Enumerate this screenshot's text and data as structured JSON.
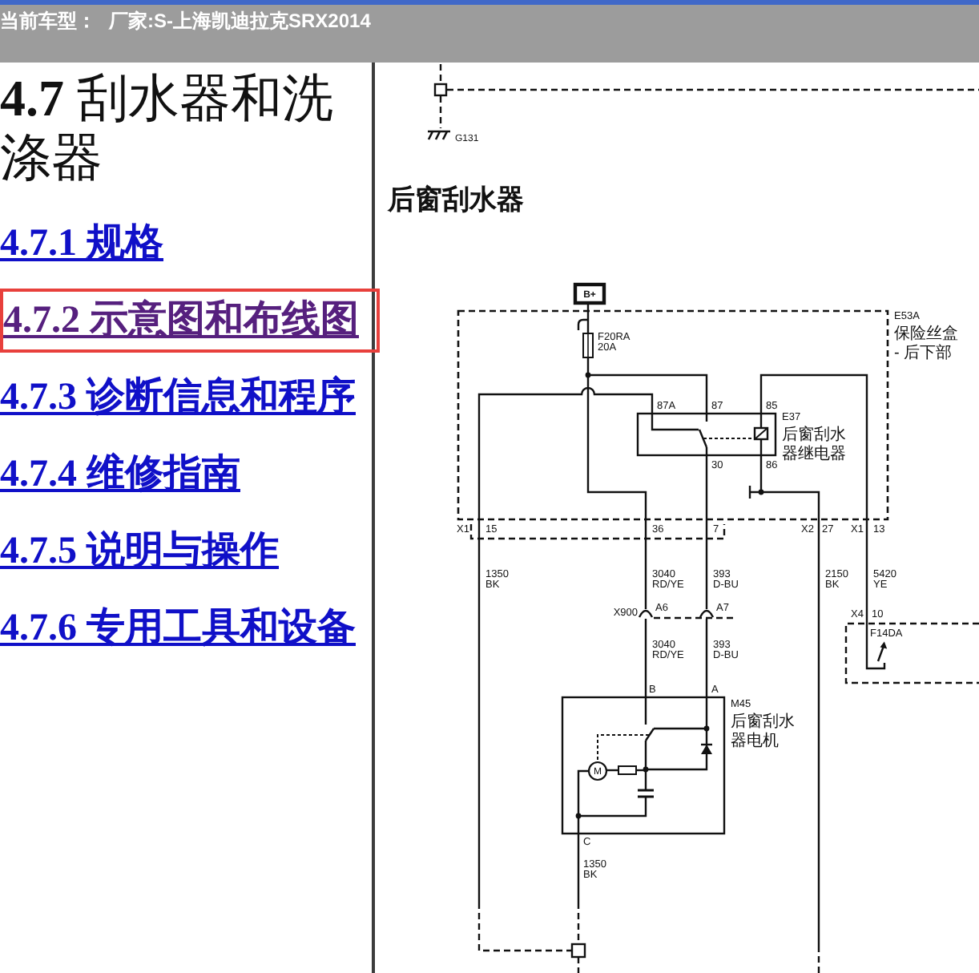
{
  "header": {
    "label": "当前车型：",
    "value": "厂家:S-上海凯迪拉克SRX2014"
  },
  "toc": {
    "heading": "**4.7** 刮水器和洗涤器",
    "links": [
      {
        "label": "4.7.1 规格",
        "selected": false
      },
      {
        "label": "4.7.2 示意图和布线图",
        "selected": true
      },
      {
        "label": "4.7.3 诊断信息和程序",
        "selected": false
      },
      {
        "label": "4.7.4 维修指南",
        "selected": false
      },
      {
        "label": "4.7.5 说明与操作",
        "selected": false
      },
      {
        "label": "4.7.6 专用工具和设备",
        "selected": false
      }
    ]
  },
  "document": {
    "previous_diagram": {
      "ground": "G131"
    },
    "title": "后窗刮水器",
    "diagram": {
      "power": "B+",
      "fuse_block": {
        "lines": [
          "E53A",
          "保险丝盒",
          "- 后下部"
        ]
      },
      "fuse": {
        "lines": [
          "F20RA",
          "20A"
        ]
      },
      "relay": {
        "lines": [
          "E37",
          "后窗刮水",
          "器继电器"
        ],
        "pins": [
          "87A",
          "87",
          "85",
          "30",
          "86"
        ]
      },
      "harness_pins": [
        {
          "connector": "X1",
          "pin": "15"
        },
        {
          "pin": "36"
        },
        {
          "pin": "7"
        },
        {
          "connector": "X2",
          "pin": "27"
        },
        {
          "connector": "X1",
          "pin": "13"
        }
      ],
      "wires": [
        {
          "circuit": "1350",
          "insulation": "BK"
        },
        {
          "circuit": "3040",
          "insulation": "RD/YE"
        },
        {
          "circuit": "393",
          "insulation": "D-BU"
        },
        {
          "circuit": "2150",
          "insulation": "BK"
        },
        {
          "circuit": "5420",
          "insulation": "YE"
        }
      ],
      "inline_connector": {
        "name": "X900",
        "pins": [
          "A6",
          "A7"
        ]
      },
      "motor_wires": [
        {
          "circuit": "3040",
          "insulation": "RD/YE"
        },
        {
          "circuit": "393",
          "insulation": "D-BU"
        }
      ],
      "motor": {
        "lines": [
          "M45",
          "后窗刮水",
          "器电机"
        ],
        "symbol": "M",
        "pins": [
          "B",
          "A",
          "C"
        ]
      },
      "ground_wire": {
        "circuit": "1350",
        "insulation": "BK"
      },
      "right_connector": {
        "name": "X4",
        "pin": "10"
      },
      "right_device": "F14DA"
    }
  }
}
